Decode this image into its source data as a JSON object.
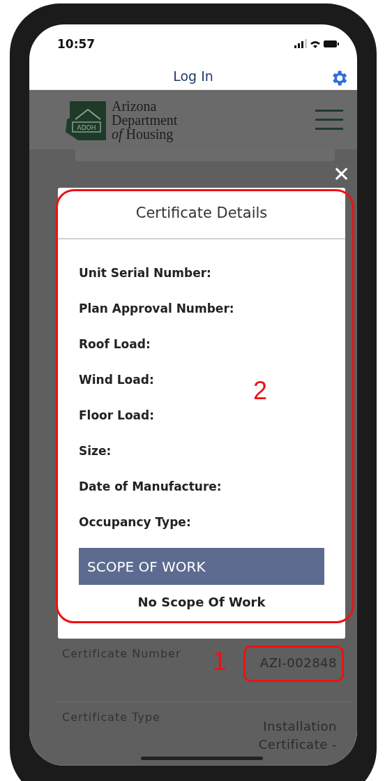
{
  "status_bar": {
    "time": "10:57"
  },
  "nav_bar": {
    "title": "Log In"
  },
  "close_button": "✕",
  "header": {
    "logo_badge": "ADOH",
    "logo_lines": [
      "Arizona",
      "Department",
      "*of* Housing"
    ]
  },
  "modal": {
    "title": "Certificate Details",
    "fields": [
      "Unit Serial Number:",
      "Plan Approval Number:",
      "Roof Load:",
      "Wind Load:",
      "Floor Load:",
      "Size:",
      "Date of Manufacture:",
      "Occupancy Type:"
    ],
    "section_title": "SCOPE OF WORK",
    "section_text": "No Scope Of Work",
    "annotation": "2"
  },
  "rows": [
    {
      "label": "Certificate Number",
      "value_lines": [
        "AZI-002848"
      ],
      "annotation": "1"
    },
    {
      "label": "Certificate Type",
      "value_lines": [
        "Installation",
        "Certificate -"
      ]
    }
  ]
}
